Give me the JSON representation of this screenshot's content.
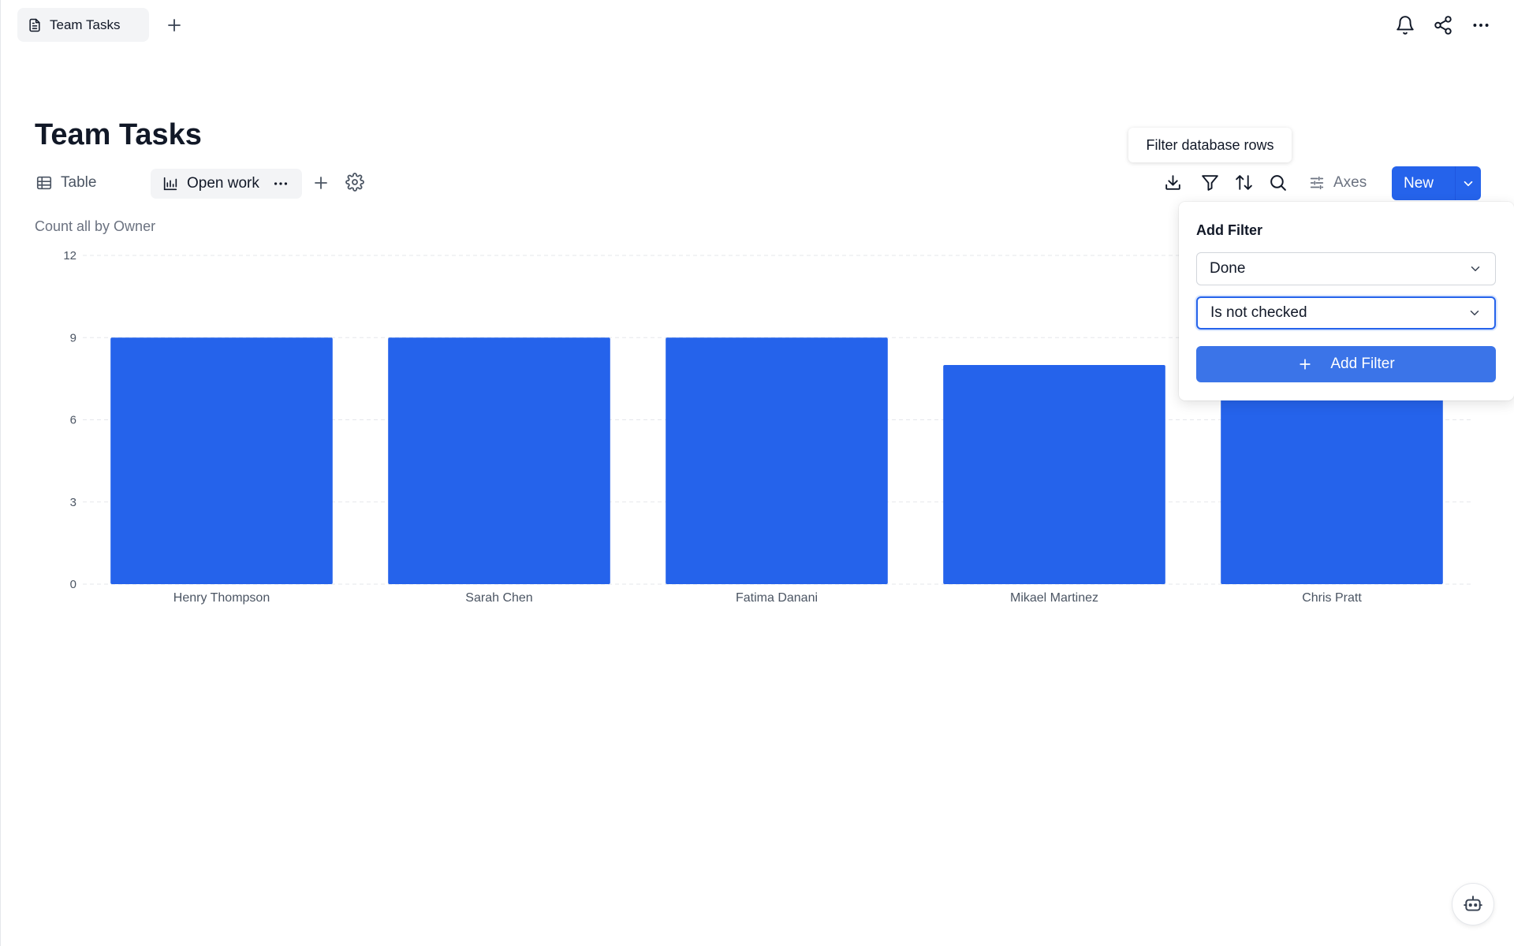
{
  "tabs": [
    {
      "label": "Team Tasks",
      "icon": "document-icon"
    }
  ],
  "page": {
    "title": "Team Tasks"
  },
  "views": {
    "table_label": "Table",
    "active_label": "Open work"
  },
  "toolbar": {
    "axes_label": "Axes",
    "new_label": "New",
    "tooltip": "Filter database rows"
  },
  "chart_data": {
    "type": "bar",
    "subtitle": "Count all by Owner",
    "categories": [
      "Henry Thompson",
      "Sarah Chen",
      "Fatima Danani",
      "Mikael Martinez",
      "Chris Pratt"
    ],
    "values": [
      9,
      9,
      9,
      8,
      9
    ],
    "yticks": [
      0,
      3,
      6,
      9,
      12
    ],
    "ylim": [
      0,
      12
    ],
    "grid": true,
    "color": "#2563eb"
  },
  "filter": {
    "title": "Add Filter",
    "field_value": "Done",
    "condition_value": "Is not checked",
    "add_label": "Add Filter"
  },
  "colors": {
    "accent": "#2563eb"
  }
}
